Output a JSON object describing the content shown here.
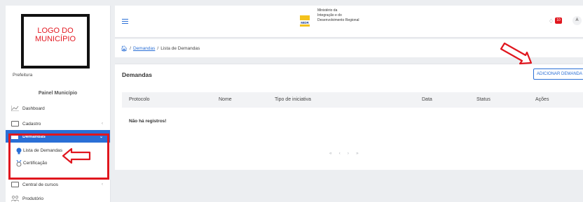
{
  "sidebar": {
    "logo_text": "LOGO DO\nMUNICÍPIO",
    "prefeitura": "Prefeitura",
    "panel_title": "Painel Município",
    "items": [
      {
        "label": "Dashboard",
        "icon": "chart-line-icon"
      },
      {
        "label": "Cadastro",
        "icon": "folder-icon",
        "chevron": "‹"
      },
      {
        "label": "Demandas",
        "icon": "folder-open-icon",
        "chevron": "⌄"
      },
      {
        "label": "Lista de Demandas",
        "icon": "lightbulb-icon"
      },
      {
        "label": "Certificação",
        "icon": "certificate-icon"
      },
      {
        "label": "Central de cursos",
        "icon": "folder-icon",
        "chevron": "‹"
      },
      {
        "label": "Produtório",
        "icon": "people-icon"
      }
    ]
  },
  "header": {
    "ministry": "Ministério da\nIntegração e do\nDesenvolvimento Regional",
    "ministry_logo": "MIDR",
    "badge": "10",
    "avatar": "A"
  },
  "breadcrumb": {
    "link": "Demandas",
    "sep": "/",
    "current": "Lista de Demandas"
  },
  "card": {
    "title": "Demandas",
    "add_label": "ADICIONAR DEMANDA",
    "columns": [
      "Protocolo",
      "Nome",
      "Tipo de iniciativa",
      "Data",
      "Status",
      "Ações"
    ],
    "empty": "Não há registros!",
    "pager": [
      "«",
      "‹",
      "›",
      "»"
    ]
  },
  "colors": {
    "accent": "#2a6fd6",
    "annotation": "#e0161e"
  }
}
